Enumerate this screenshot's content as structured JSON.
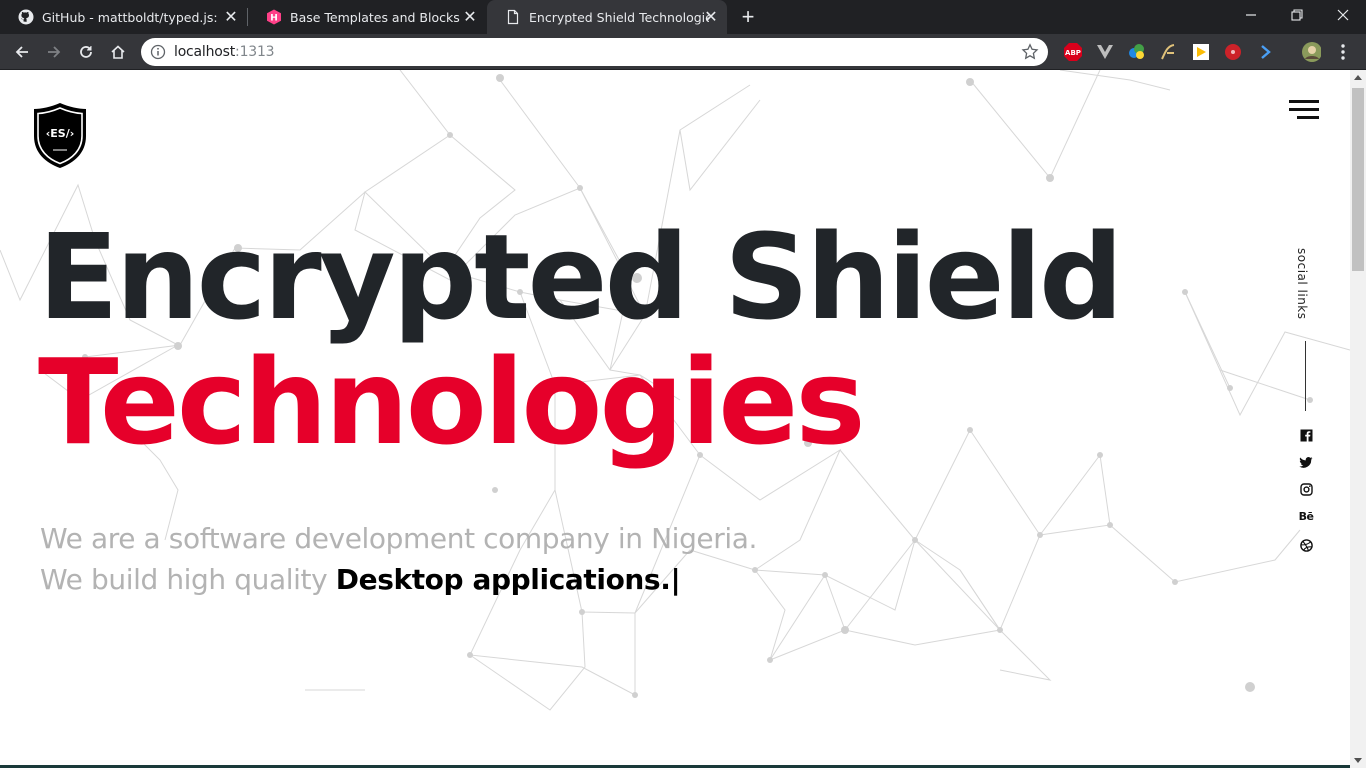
{
  "browser": {
    "tabs": [
      {
        "title": "GitHub - mattboldt/typed.js: A Ja",
        "icon": "github-icon",
        "active": false
      },
      {
        "title": "Base Templates and Blocks | Hug",
        "icon": "hugo-icon",
        "active": false
      },
      {
        "title": "Encrypted Shield Technologies",
        "icon": "document-icon",
        "active": true
      }
    ],
    "close_glyph": "✕",
    "new_tab_glyph": "+",
    "address": {
      "host": "localhost",
      "port": ":1313"
    },
    "extensions": [
      "adblock-plus-icon",
      "vue-devtools-icon",
      "color-picker-icon",
      "font-icon",
      "google-keep-icon",
      "lastpass-icon",
      "arrow-extension-icon",
      "profile-avatar-icon",
      "menu-kebab-icon"
    ],
    "extension_labels": {
      "abp": "ABP"
    }
  },
  "site": {
    "logo_text": "‹ES/›",
    "headline_line1": "Encrypted Shield",
    "headline_line2": "Technologies",
    "tagline_line1": "We are a software development company in Nigeria.",
    "tagline_prefix": "We build high quality",
    "typed_text": "Desktop applications.",
    "typed_cursor": "|",
    "social_label": "social links",
    "social_icons": [
      "facebook-icon",
      "twitter-icon",
      "instagram-icon",
      "behance-icon",
      "dribbble-icon"
    ],
    "social_glyphs": {
      "behance": "Bē"
    }
  },
  "colors": {
    "headline_dark": "#212529",
    "headline_accent": "#e6002a",
    "tagline_gray": "#b3b3b3",
    "chrome_dark": "#202124",
    "chrome_toolbar": "#35363a"
  }
}
